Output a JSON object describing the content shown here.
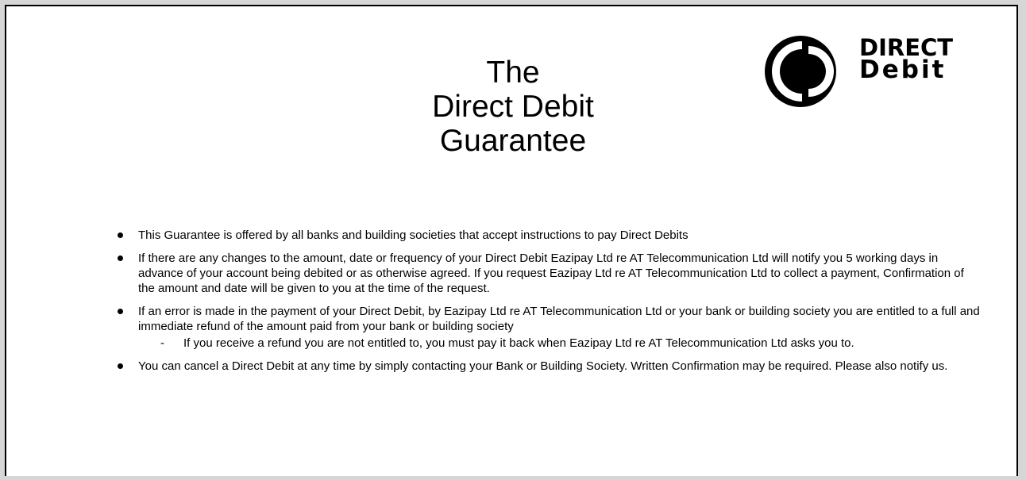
{
  "title": {
    "line1": "The",
    "line2": "Direct Debit",
    "line3": "Guarantee"
  },
  "logo": {
    "line1": "DIRECT",
    "line2": "Debit",
    "icon": "direct-debit-logo"
  },
  "items": [
    {
      "text": "This Guarantee is offered by all banks and building societies that accept instructions to pay Direct Debits"
    },
    {
      "text": "If there are any changes to the amount, date or frequency of your Direct Debit Eazipay Ltd re AT Telecommunication Ltd will notify you 5 working days in advance of your account being debited or as otherwise agreed. If you request Eazipay Ltd re AT Telecommunication Ltd to collect a payment, Confirmation of the amount and date will be given to you at the time of the request."
    },
    {
      "text": "If an error is made in the payment of your Direct Debit, by Eazipay Ltd re AT Telecommunication Ltd or your bank or building society you are entitled to a full and immediate refund of the amount paid from your bank or building society",
      "sub": "If you receive a refund you are not entitled to, you must pay it back when Eazipay Ltd re AT Telecommunication Ltd asks you to."
    },
    {
      "text": "You can cancel a Direct Debit at any time by simply contacting your Bank or Building Society. Written Confirmation may be required. Please also notify us."
    }
  ],
  "colors": {
    "background": "#d6d6d6",
    "panel": "#ffffff",
    "text": "#000000"
  }
}
